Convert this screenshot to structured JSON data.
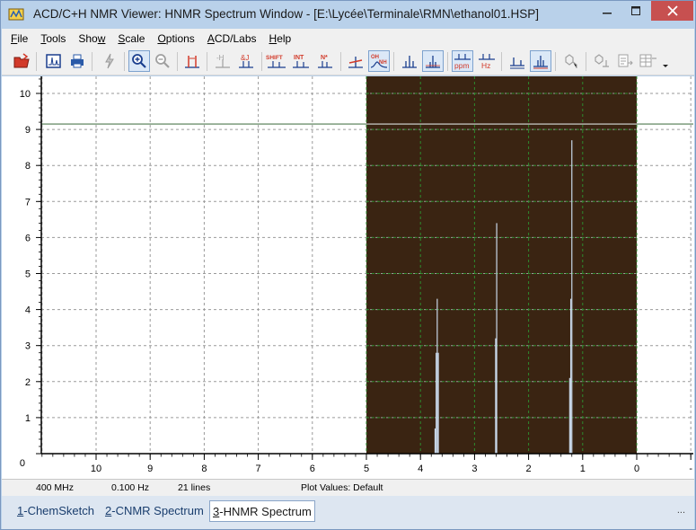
{
  "window": {
    "title": "ACD/C+H NMR Viewer: HNMR Spectrum Window - [E:\\Lycée\\Terminale\\RMN\\ethanol01.HSP]",
    "colors": {
      "titlebar": "#b9d1ea",
      "close": "#c75050",
      "plot_dark": "#3a2412",
      "grid": "#2e8b2e",
      "peak": "#c9d8ea"
    }
  },
  "menu": [
    {
      "key": "F",
      "rest": "ile"
    },
    {
      "key": "T",
      "rest": "ools"
    },
    {
      "key": "",
      "pre": "Sho",
      "rest": "w",
      "ukey": "w"
    },
    {
      "key": "S",
      "rest": "cale"
    },
    {
      "key": "O",
      "rest": "ptions"
    },
    {
      "key": "A",
      "rest": "CD/Labs"
    },
    {
      "key": "H",
      "rest": "elp"
    }
  ],
  "toolbar": {
    "icons": [
      "open-icon",
      "spectrum-icon",
      "print-icon",
      "lightning-icon",
      "zoom-in-icon",
      "zoom-out-icon",
      "peak-width-icon",
      "h-icon",
      "j-coupling-icon",
      "shift-icon",
      "int-icon",
      "nh-icon",
      "peak-pick-icon",
      "oh-nh-icon",
      "stack-icon",
      "spectrum-view-icon",
      "ppm-icon",
      "hz-icon",
      "baseline-icon",
      "expand-icon",
      "structure-icon",
      "assign-icon",
      "export-icon",
      "table-icon"
    ],
    "labels": {
      "shift": "SHIFT",
      "int": "INT",
      "nh": "N*",
      "ohnh": "OH NH",
      "ppm": "ppm",
      "hz": "Hz",
      "h": "-H",
      "j": "&J"
    }
  },
  "chart_data": {
    "type": "line",
    "title": "",
    "xlabel": "",
    "ylabel": "",
    "x_ticks": [
      "10",
      "9",
      "8",
      "7",
      "6",
      "5",
      "4",
      "3",
      "2",
      "1",
      "0",
      "-"
    ],
    "y_ticks": [
      "0",
      "1",
      "2",
      "3",
      "4",
      "5",
      "6",
      "7",
      "8",
      "9",
      "10"
    ],
    "xlim": [
      11,
      -1
    ],
    "ylim": [
      0,
      10.5
    ],
    "grid": true,
    "highlight_region_ppm": [
      5,
      0
    ],
    "threshold_line_y": 9.15,
    "peaks": [
      {
        "ppm": 3.7,
        "height": 4.3,
        "multiplet": [
          0.7,
          2.8,
          4.3,
          2.8
        ]
      },
      {
        "ppm": 2.6,
        "height": 6.4,
        "multiplet": [
          3.2,
          6.4
        ]
      },
      {
        "ppm": 1.22,
        "height": 8.7,
        "multiplet": [
          2.1,
          4.3,
          8.7
        ]
      }
    ]
  },
  "status": {
    "frequency": "400 MHz",
    "resolution": "0.100 Hz",
    "lines": "21 lines",
    "plot_values": "Plot Values: Default"
  },
  "tabs": [
    {
      "num": "1",
      "label": "-ChemSketch",
      "active": false
    },
    {
      "num": "2",
      "label": "-CNMR Spectrum",
      "active": false
    },
    {
      "num": "3",
      "label": "-HNMR Spectrum",
      "active": true
    }
  ],
  "tabs_more": "..."
}
